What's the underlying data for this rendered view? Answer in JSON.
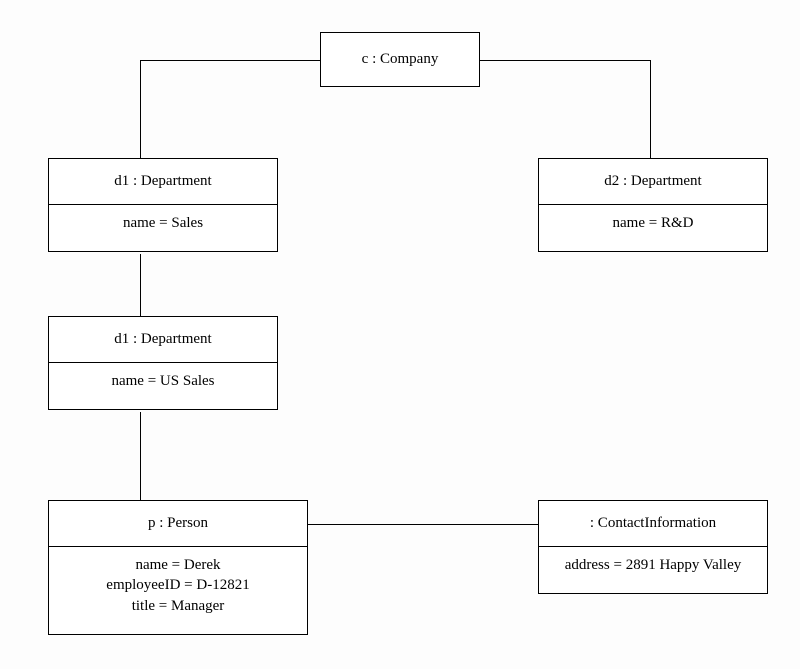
{
  "boxes": {
    "company": {
      "title": "c : Company"
    },
    "d1": {
      "title": "d1 : Department",
      "name": "name = Sales"
    },
    "d2": {
      "title": "d2 : Department",
      "name": "name = R&D"
    },
    "d3": {
      "title": "d1 : Department",
      "name": "name = US Sales"
    },
    "person": {
      "title": "p : Person",
      "attrs": {
        "name": "name = Derek",
        "employeeID": "employeeID = D-12821",
        "title": "title = Manager"
      }
    },
    "contact": {
      "title": ": ContactInformation",
      "address": "address = 2891 Happy Valley"
    }
  }
}
